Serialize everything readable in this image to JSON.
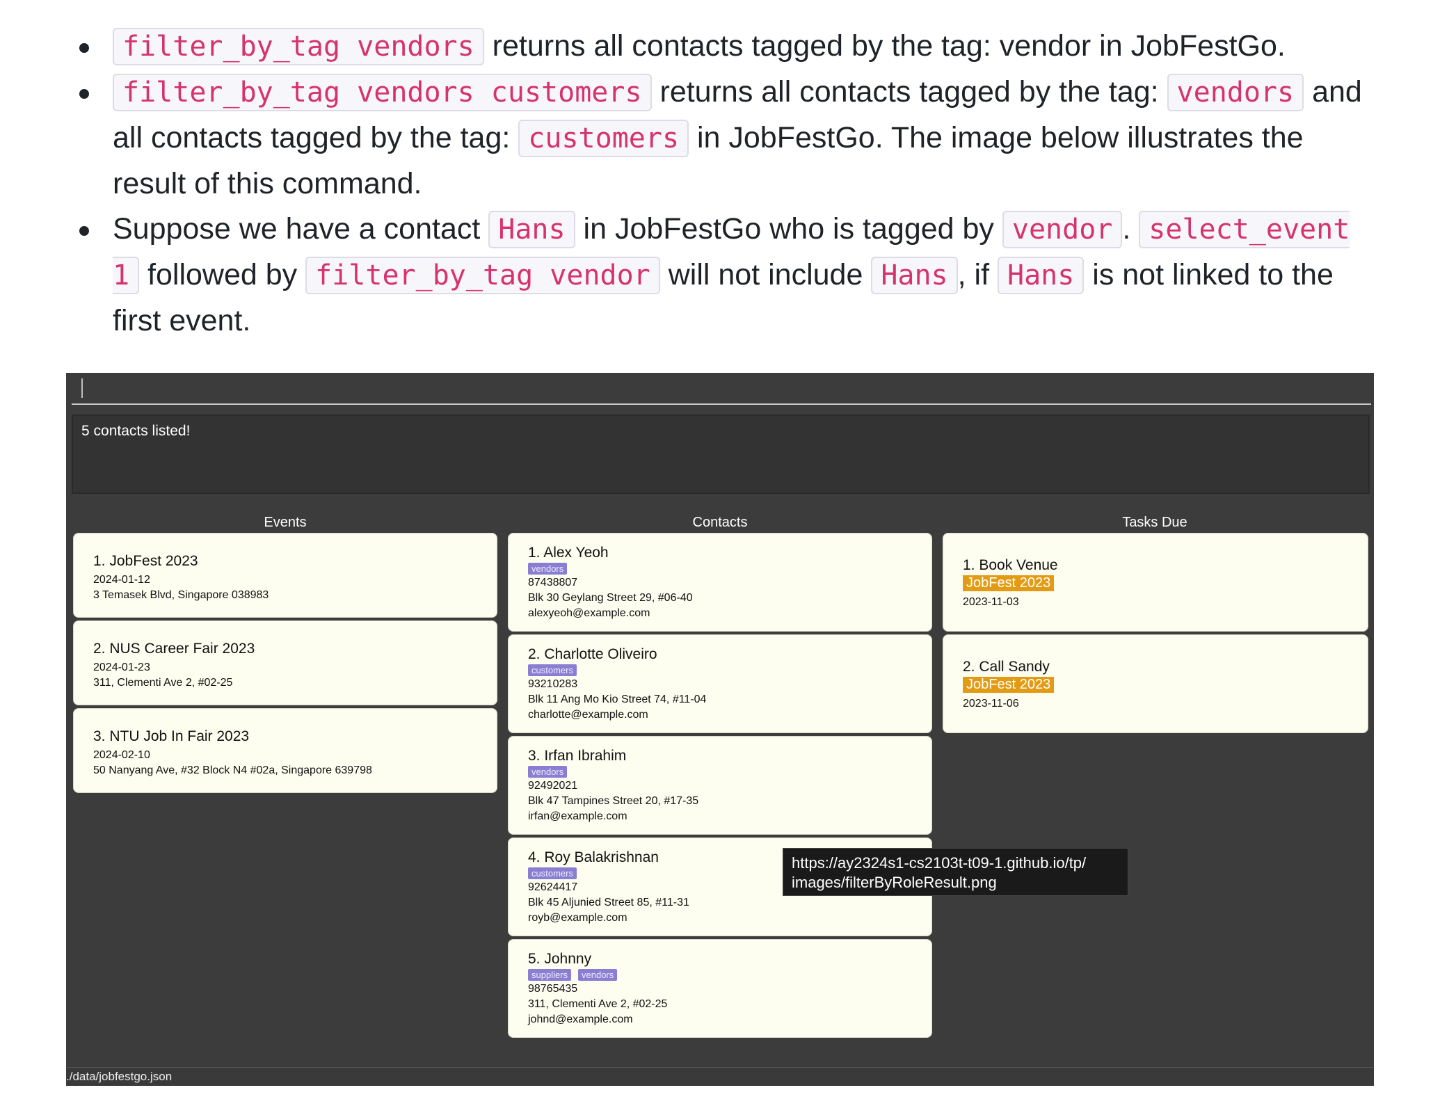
{
  "doc": {
    "b1": {
      "code": "filter_by_tag vendors",
      "text": " returns all contacts tagged by the tag: vendor in JobFestGo."
    },
    "b2": {
      "code1": "filter_by_tag vendors customers",
      "text1": " returns all contacts tagged by the tag: ",
      "code2": "vendors",
      "text2": " and all contacts tagged by the tag: ",
      "code3": "customers",
      "text3": " in JobFestGo. The image below illustrates the result of this command."
    },
    "b3": {
      "text1": "Suppose we have a contact ",
      "code1": "Hans",
      "text2": " in JobFestGo who is tagged by ",
      "code2": "vendor",
      "text3": ". ",
      "code3": "select_event 1",
      "text4": " followed by ",
      "code4": "filter_by_tag vendor",
      "text5": " will not include ",
      "code5": "Hans",
      "text6": ", if ",
      "code6": "Hans",
      "text7": " is not linked to the first event."
    }
  },
  "app": {
    "result_text": "5 contacts listed!",
    "events_title": "Events",
    "contacts_title": "Contacts",
    "tasks_title": "Tasks Due",
    "events": [
      {
        "name": "1.  JobFest 2023",
        "date": "2024-01-12",
        "address": "3 Temasek Blvd, Singapore 038983"
      },
      {
        "name": "2.  NUS Career Fair 2023",
        "date": "2024-01-23",
        "address": "311, Clementi Ave 2, #02-25"
      },
      {
        "name": "3.  NTU Job In Fair 2023",
        "date": "2024-02-10",
        "address": "50 Nanyang Ave, #32 Block N4 #02a, Singapore 639798"
      }
    ],
    "contacts": [
      {
        "name": "1.  Alex Yeoh",
        "tags": [
          "vendors"
        ],
        "phone": "87438807",
        "address": "Blk 30 Geylang Street 29, #06-40",
        "email": "alexyeoh@example.com"
      },
      {
        "name": "2.  Charlotte Oliveiro",
        "tags": [
          "customers"
        ],
        "phone": "93210283",
        "address": "Blk 11 Ang Mo Kio Street 74, #11-04",
        "email": "charlotte@example.com"
      },
      {
        "name": "3.  Irfan Ibrahim",
        "tags": [
          "vendors"
        ],
        "phone": "92492021",
        "address": "Blk 47 Tampines Street 20, #17-35",
        "email": "irfan@example.com"
      },
      {
        "name": "4.  Roy Balakrishnan",
        "tags": [
          "customers"
        ],
        "phone": "92624417",
        "address": "Blk 45 Aljunied Street 85, #11-31",
        "email": "royb@example.com"
      },
      {
        "name": "5.  Johnny",
        "tags": [
          "suppliers",
          "vendors"
        ],
        "phone": "98765435",
        "address": "311, Clementi Ave 2, #02-25",
        "email": "johnd@example.com"
      }
    ],
    "tasks": [
      {
        "name": "1.  Book Venue",
        "event": "JobFest 2023",
        "date": "2023-11-03"
      },
      {
        "name": "2.  Call Sandy",
        "event": "JobFest 2023",
        "date": "2023-11-06"
      }
    ],
    "status_path": "./data/jobfestgo.json"
  },
  "tooltip": {
    "line1": "https://ay2324s1-cs2103t-t09-1.github.io/tp/",
    "line2": "images/filterByRoleResult.png"
  }
}
